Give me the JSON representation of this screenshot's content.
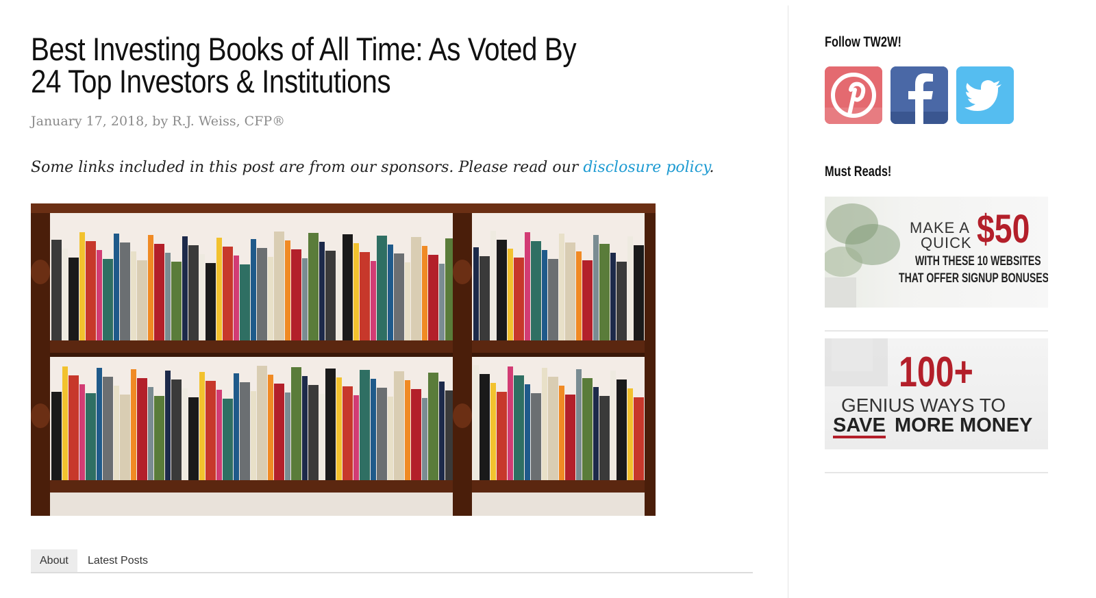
{
  "post": {
    "title": "Best Investing Books of All Time: As Voted By 24 Top Investors & Institutions",
    "meta": "January 17, 2018, by R.J. Weiss, CFP®",
    "disclosure_text": "Some links included in this post are from our sponsors. Please read our ",
    "disclosure_link": "disclosure policy",
    "disclosure_end": ".",
    "image_icon": "bookshelf-image"
  },
  "tabs": [
    {
      "label": "About",
      "active": true
    },
    {
      "label": "Latest Posts",
      "active": false
    }
  ],
  "sidebar": {
    "follow_title": "Follow TW2W!",
    "social": [
      {
        "name": "pinterest",
        "icon": "pinterest-icon",
        "color": "#e0555c"
      },
      {
        "name": "facebook",
        "icon": "facebook-icon",
        "color": "#3f5f9a"
      },
      {
        "name": "twitter",
        "icon": "twitter-icon",
        "color": "#4fb8ee"
      }
    ],
    "must_reads_title": "Must Reads!",
    "promo1": {
      "make_a": "MAKE A",
      "quick": "QUICK",
      "amount": "$50",
      "line1": "WITH THESE 10 WEBSITES",
      "line2": "THAT OFFER SIGNUP BONUSES"
    },
    "promo2": {
      "number": "100+",
      "line1": "GENIUS WAYS TO",
      "save": "SAVE",
      "rest": "MORE MONEY"
    }
  },
  "colors": {
    "link": "#1e9bd2",
    "promo_red": "#b31f2a",
    "meta_gray": "#8a8a8a"
  }
}
